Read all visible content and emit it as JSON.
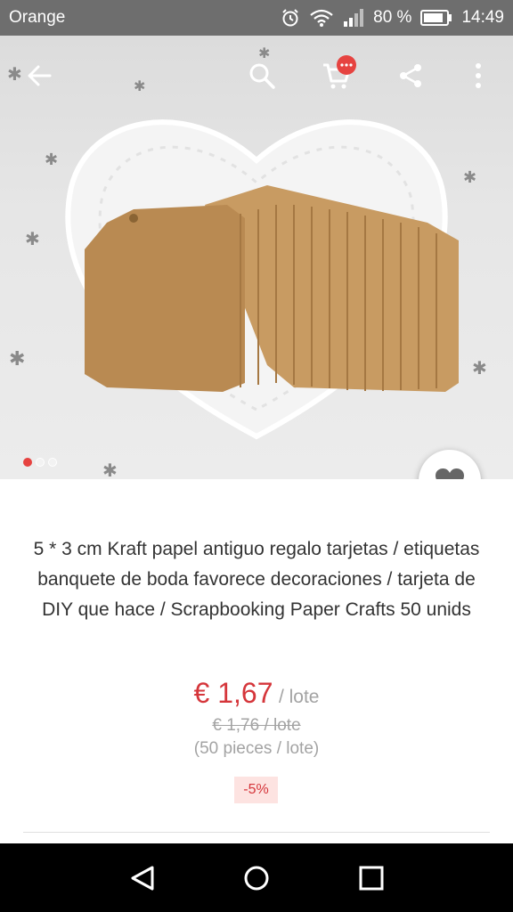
{
  "status_bar": {
    "carrier": "Orange",
    "battery": "80 %",
    "time": "14:49",
    "icons": [
      "alarm-icon",
      "wifi-icon",
      "signal-icon",
      "battery-icon"
    ]
  },
  "toolbar": {
    "icons": [
      "back-arrow-icon",
      "search-icon",
      "cart-icon",
      "share-icon",
      "more-vertical-icon"
    ],
    "cart_badge": "•••"
  },
  "gallery": {
    "pages": 3,
    "active_page": 1
  },
  "product": {
    "title": "5 * 3 cm Kraft papel antiguo regalo tarjetas / etiquetas banquete de boda favorece decoraciones / tarjeta de DIY que hace / Scrapbooking Paper Crafts 50 unids",
    "price": "€ 1,67",
    "price_unit": "/ lote",
    "old_price": "€ 1,76 / lote",
    "pieces": "(50 pieces / lote)",
    "discount": "-5%"
  },
  "colors": {
    "accent": "#d5363b",
    "badge": "#e64340",
    "muted": "#a3a3a3",
    "status_bar": "#6e6e6e"
  },
  "nav_bar": {
    "icons": [
      "nav-back-icon",
      "nav-home-icon",
      "nav-recent-icon"
    ]
  }
}
